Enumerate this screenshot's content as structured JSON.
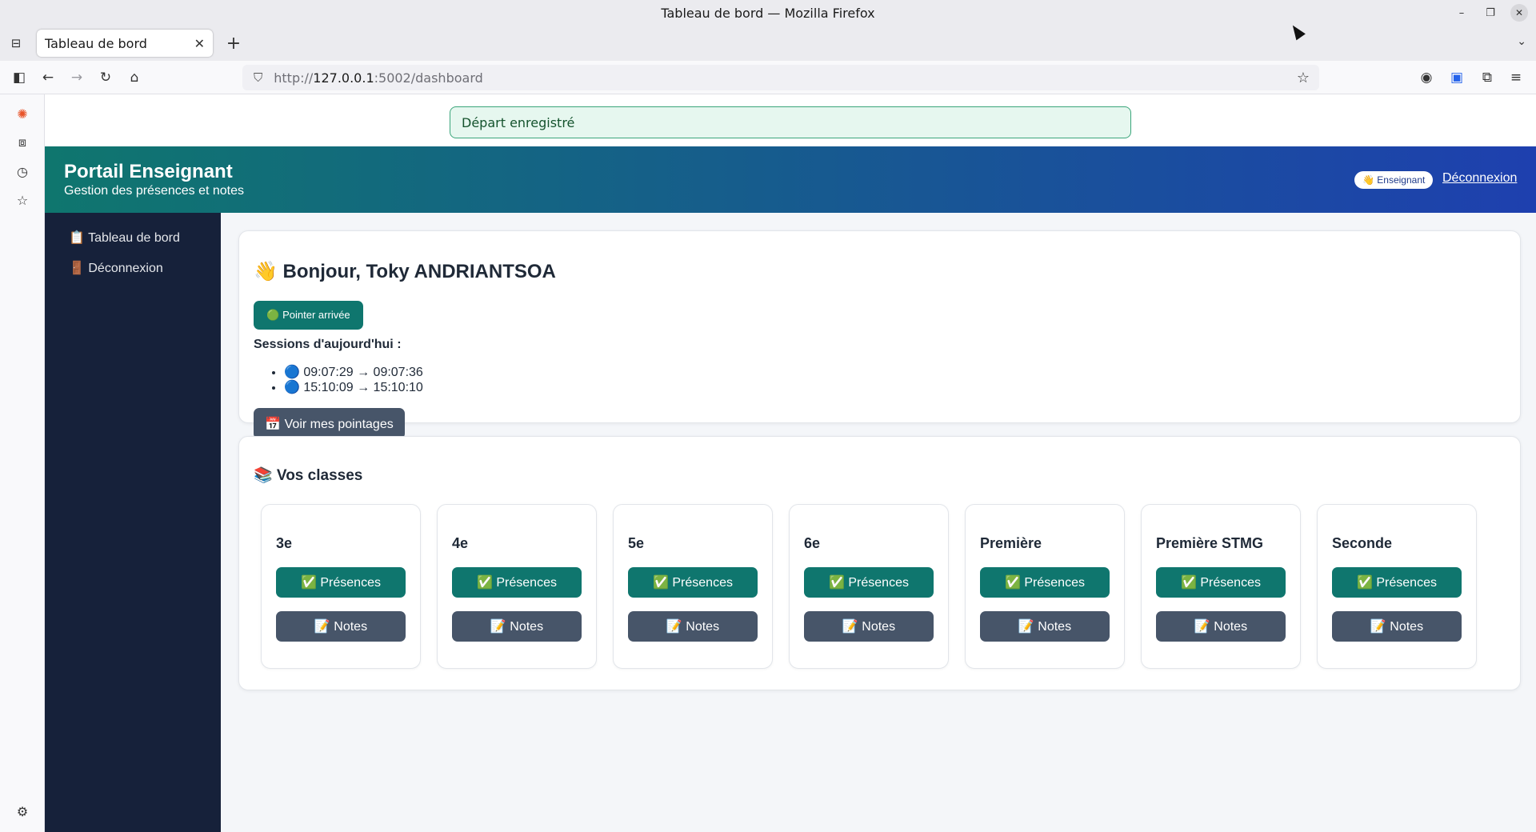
{
  "window": {
    "title": "Tableau de bord — Mozilla Firefox"
  },
  "browser": {
    "tab_title": "Tableau de bord",
    "url_prefix": "http://",
    "url_host": "127.0.0.1",
    "url_path": ":5002/dashboard"
  },
  "flash": {
    "message": "Départ enregistré"
  },
  "header": {
    "title": "Portail Enseignant",
    "subtitle": "Gestion des présences et notes",
    "role_badge": "👋 Enseignant",
    "logout": "Déconnexion"
  },
  "sidebar": {
    "items": [
      {
        "label": "📋 Tableau de bord"
      },
      {
        "label": "🚪 Déconnexion"
      }
    ]
  },
  "welcome": {
    "greeting": "👋 Bonjour, Toky ANDRIANTSOA",
    "punch_button": "🟢 Pointer arrivée",
    "sessions_label": "Sessions d'aujourd'hui :",
    "sessions": [
      "🔵 09:07:29 → 09:07:36",
      "🔵 15:10:09 → 15:10:10"
    ],
    "history_button": "📅 Voir mes pointages"
  },
  "classes": {
    "title": "📚 Vos classes",
    "presence_label": "✅ Présences",
    "notes_label": "📝 Notes",
    "items": [
      {
        "name": "3e"
      },
      {
        "name": "4e"
      },
      {
        "name": "5e"
      },
      {
        "name": "6e"
      },
      {
        "name": "Première"
      },
      {
        "name": "Première STMG"
      },
      {
        "name": "Seconde"
      }
    ]
  }
}
